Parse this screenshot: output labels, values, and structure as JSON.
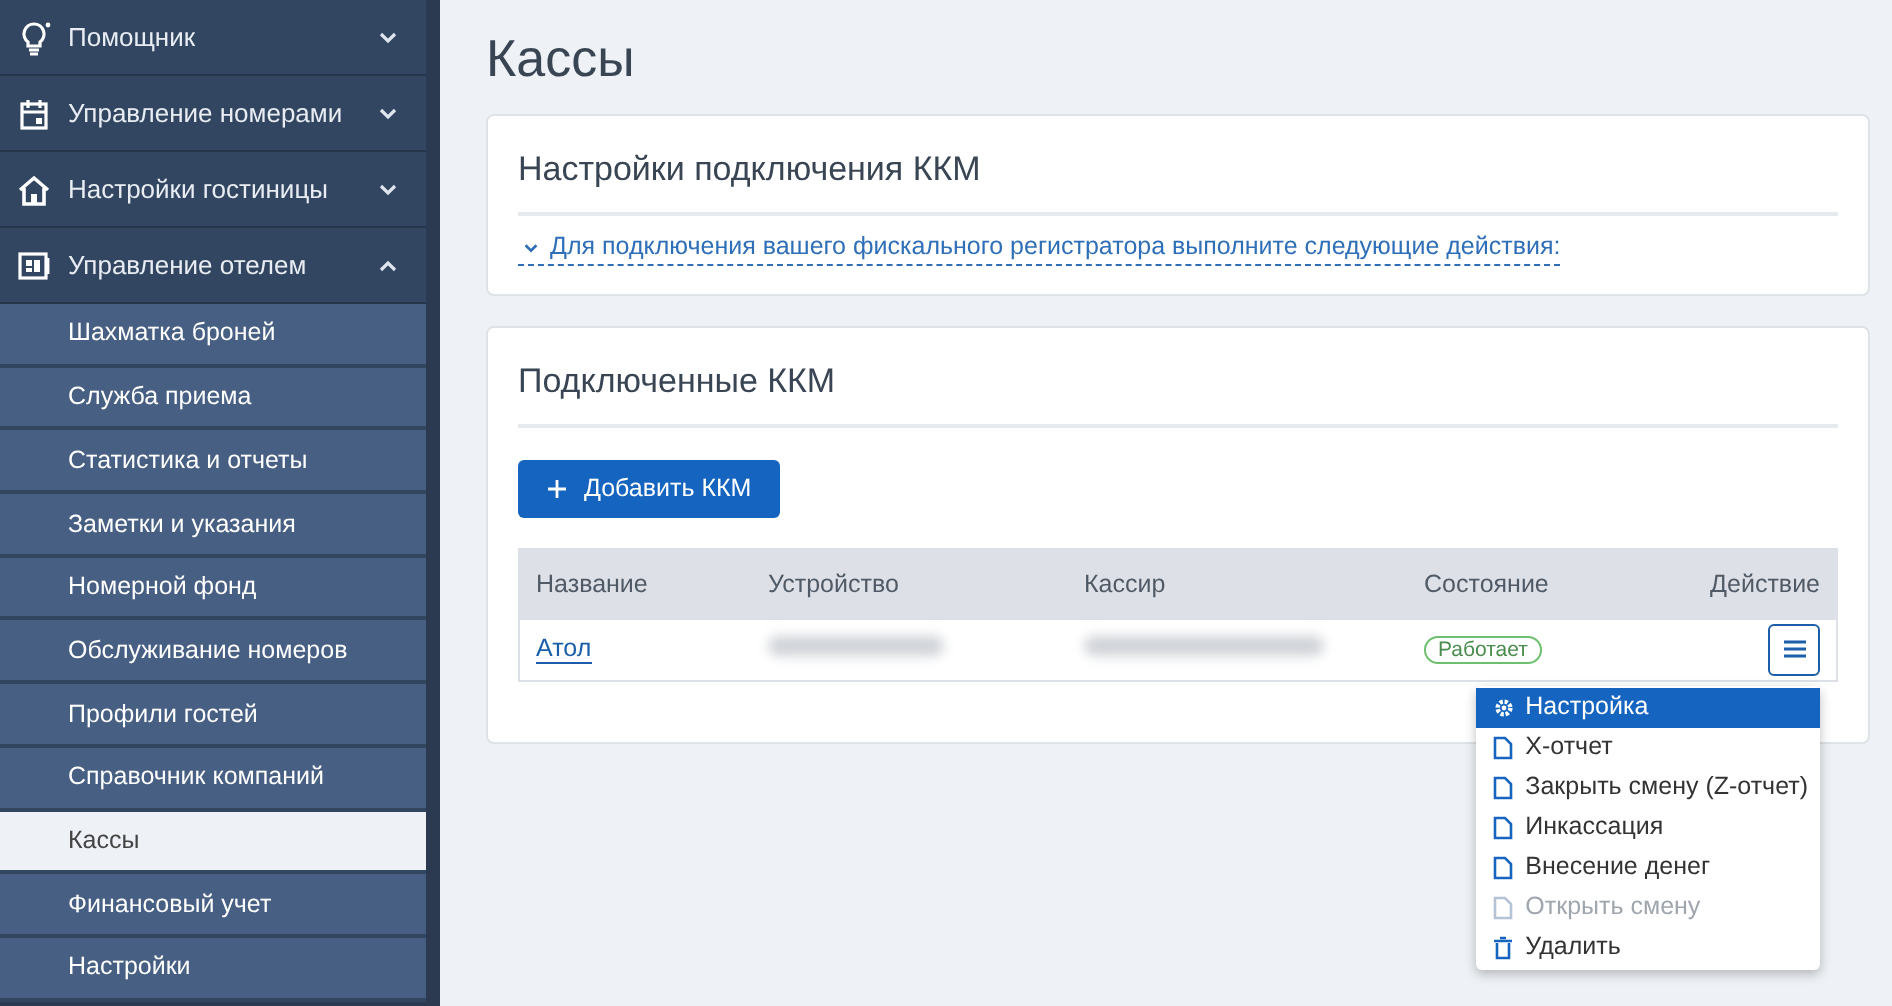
{
  "sidebar": {
    "items": [
      {
        "label": "Помощник",
        "expanded": false
      },
      {
        "label": "Управление номерами",
        "expanded": false
      },
      {
        "label": "Настройки гостиницы",
        "expanded": false
      },
      {
        "label": "Управление отелем",
        "expanded": true,
        "children": [
          {
            "label": "Шахматка броней",
            "selected": false
          },
          {
            "label": "Служба приема",
            "selected": false
          },
          {
            "label": "Статистика и отчеты",
            "selected": false
          },
          {
            "label": "Заметки и указания",
            "selected": false
          },
          {
            "label": "Номерной фонд",
            "selected": false
          },
          {
            "label": "Обслуживание номеров",
            "selected": false
          },
          {
            "label": "Профили гостей",
            "selected": false
          },
          {
            "label": "Справочник компаний",
            "selected": false
          },
          {
            "label": "Кассы",
            "selected": true
          },
          {
            "label": "Финансовый учет",
            "selected": false
          },
          {
            "label": "Настройки",
            "selected": false
          }
        ]
      }
    ]
  },
  "page_title": "Кассы",
  "settings_card": {
    "title": "Настройки подключения ККМ",
    "toggle": "Для подключения вашего фискального регистратора выполните следующие действия:",
    "expanded": false
  },
  "devices_card": {
    "title": "Подключенные ККМ",
    "add_button": "Добавить ККМ",
    "table": {
      "columns": [
        "Название",
        "Устройство",
        "Кассир",
        "Состояние",
        "Действие"
      ],
      "rows": [
        {
          "cells": [
            {
              "kind": "link",
              "text": "Атол"
            },
            {
              "kind": "redacted"
            },
            {
              "kind": "redacted"
            },
            {
              "kind": "status",
              "text": "Работает"
            },
            {
              "kind": "menu"
            }
          ]
        }
      ]
    }
  },
  "action_menu": {
    "items": [
      {
        "label": "Настройка",
        "kind": "settings",
        "selected": true,
        "disabled": false
      },
      {
        "label": "X-отчет",
        "kind": "document",
        "selected": false,
        "disabled": false
      },
      {
        "label": "Закрыть смену (Z-отчет)",
        "kind": "document",
        "selected": false,
        "disabled": false
      },
      {
        "label": "Инкассация",
        "kind": "document",
        "selected": false,
        "disabled": false
      },
      {
        "label": "Внесение денег",
        "kind": "document",
        "selected": false,
        "disabled": false
      },
      {
        "label": "Открыть смену",
        "kind": "document",
        "selected": false,
        "disabled": true
      },
      {
        "label": "Удалить",
        "kind": "delete",
        "selected": false,
        "disabled": false
      }
    ]
  }
}
